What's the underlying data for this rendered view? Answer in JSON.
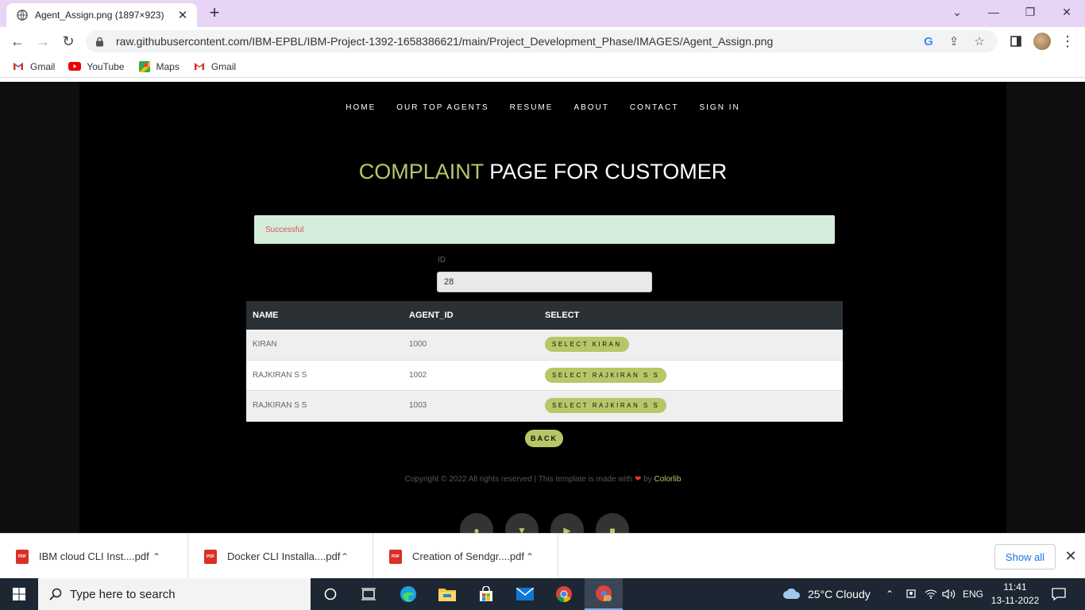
{
  "browser": {
    "tab_title": "Agent_Assign.png (1897×923)",
    "url": "raw.githubusercontent.com/IBM-EPBL/IBM-Project-1392-1658386621/main/Project_Development_Phase/IMAGES/Agent_Assign.png",
    "bookmarks": [
      "Gmail",
      "YouTube",
      "Maps",
      "Gmail"
    ]
  },
  "site": {
    "nav": [
      "HOME",
      "OUR TOP AGENTS",
      "RESUME",
      "ABOUT",
      "CONTACT",
      "SIGN IN"
    ],
    "heading_accent": "COMPLAINT",
    "heading_rest": " PAGE FOR CUSTOMER",
    "alert": "Successful",
    "id_label": "ID",
    "id_value": "28",
    "table": {
      "headers": [
        "NAME",
        "AGENT_ID",
        "SELECT"
      ],
      "rows": [
        {
          "name": "KIRAN",
          "agent_id": "1000",
          "button": "SELECT KIRAN"
        },
        {
          "name": "RAJKIRAN S S",
          "agent_id": "1002",
          "button": "SELECT RAJKIRAN S S"
        },
        {
          "name": "RAJKIRAN S S",
          "agent_id": "1003",
          "button": "SELECT RAJKIRAN S S"
        }
      ]
    },
    "back_label": "BACK",
    "copyright_text": "Copyright © 2022 All rights reserved | This template is made with ",
    "copyright_by": " by ",
    "copyright_link": "Colorlib",
    "accent_color": "#b9c667"
  },
  "downloads": {
    "items": [
      "IBM cloud CLI Inst....pdf",
      "Docker CLI Installa....pdf",
      "Creation of Sendgr....pdf"
    ],
    "show_all": "Show all"
  },
  "taskbar": {
    "search_placeholder": "Type here to search",
    "weather": "25°C  Cloudy",
    "lang": "ENG",
    "time": "11:41",
    "date": "13-11-2022"
  }
}
